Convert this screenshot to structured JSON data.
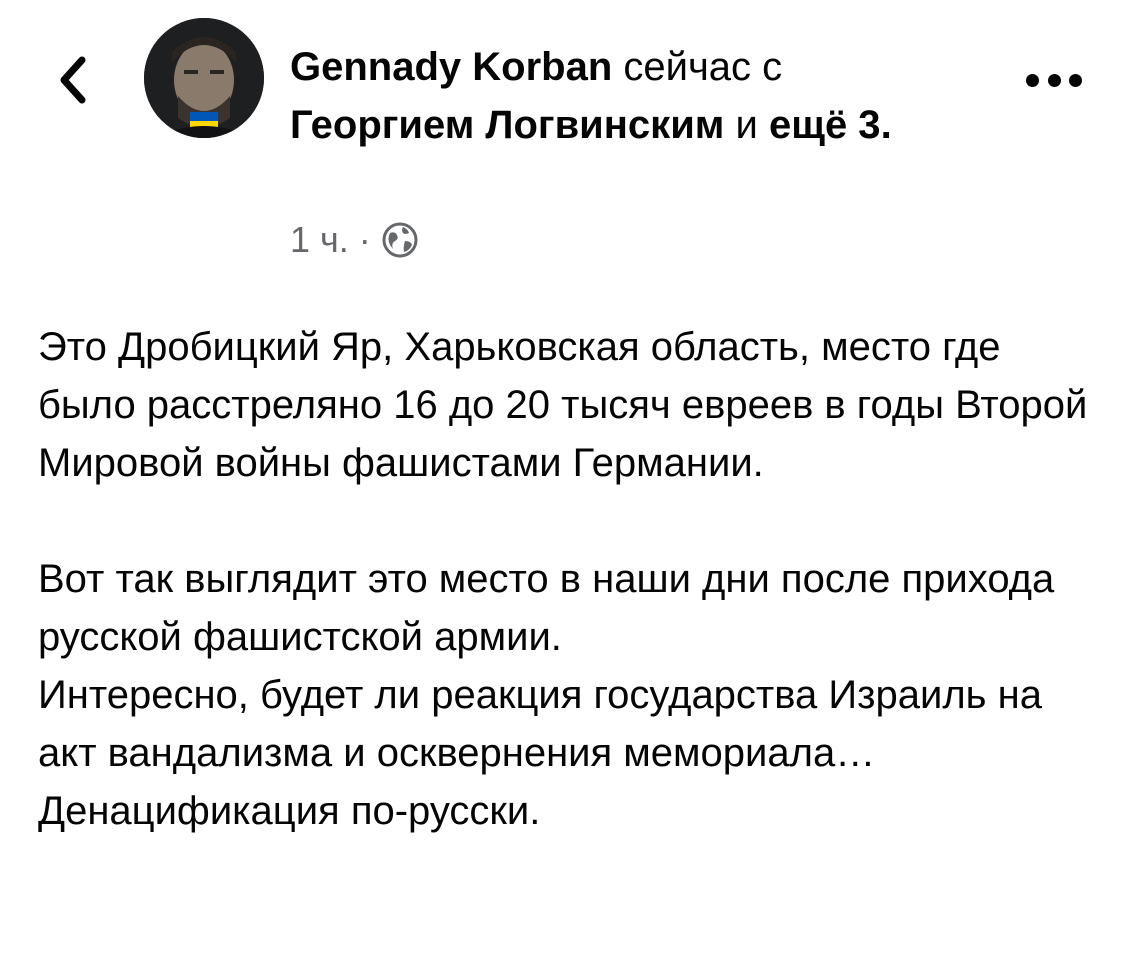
{
  "post_header": {
    "author": "Gennady Korban",
    "connector_now_with": " сейчас с ",
    "tagged_person": "Георгием Логвинским",
    "and_word": " и ",
    "more_count": "ещё 3",
    "trailing_dot": ".",
    "time": "1 ч.",
    "separator": "·",
    "privacy_icon": "globe-icon"
  },
  "post_body": {
    "paragraph_1": "Это Дробицкий Яр, Харьковская область, место где было расстреляно 16 до 20 тысяч евреев в годы Второй Мировой войны фашистами Германии.",
    "line_1": "Вот так выглядит это место в наши дни после прихода русской фашистской армии.",
    "line_2": "Интересно,  будет ли реакция государства Израиль на акт вандализма и осквернения мемориала…",
    "line_3": "Денацификация по-русски."
  },
  "icons": {
    "back": "chevron-left-icon",
    "more": "more-options-icon",
    "avatar_flag_colors": [
      "#0057b7",
      "#ffd700"
    ]
  }
}
